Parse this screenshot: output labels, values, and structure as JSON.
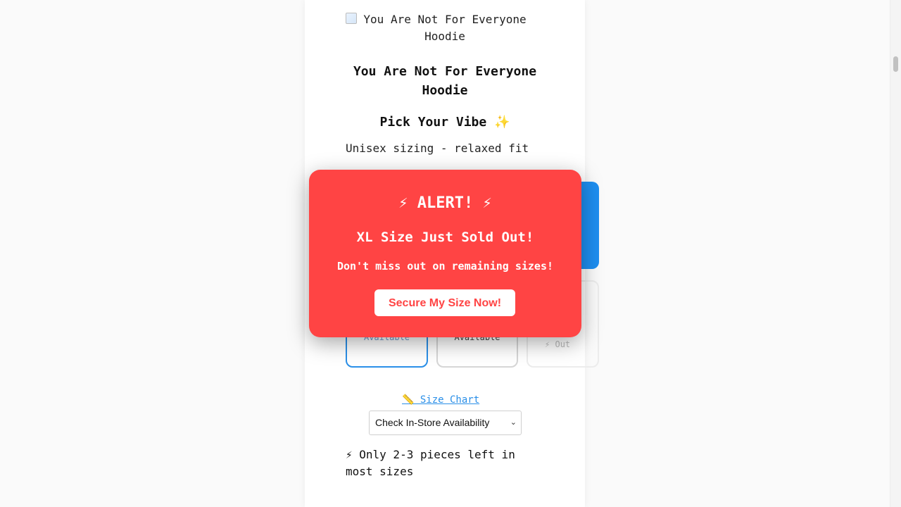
{
  "product": {
    "image_alt": "You Are Not For Everyone Hoodie",
    "title": "You Are Not For Everyone Hoodie"
  },
  "vibe": {
    "heading": "Pick Your Vibe ✨"
  },
  "sizing": {
    "note": "Unisex sizing - relaxed fit",
    "options": [
      {
        "status": "Available"
      },
      {
        "status": "Available"
      },
      {
        "status": "Out",
        "icon": "⚡"
      }
    ]
  },
  "size_chart": {
    "label": "📏 Size Chart"
  },
  "store_select": {
    "selected": "Check In-Store Availability"
  },
  "stock": {
    "note": "⚡ Only 2-3 pieces left in most sizes"
  },
  "alert": {
    "title": "⚡ ALERT! ⚡",
    "headline": "XL Size Just Sold Out!",
    "subtext": "Don't miss out on remaining sizes!",
    "cta_label": "Secure My Size Now!",
    "background_color": "#ff4444",
    "cta_text_color": "#ff4444"
  },
  "colors": {
    "accent_blue": "#1e8ef0",
    "page_background": "#fafafa"
  }
}
